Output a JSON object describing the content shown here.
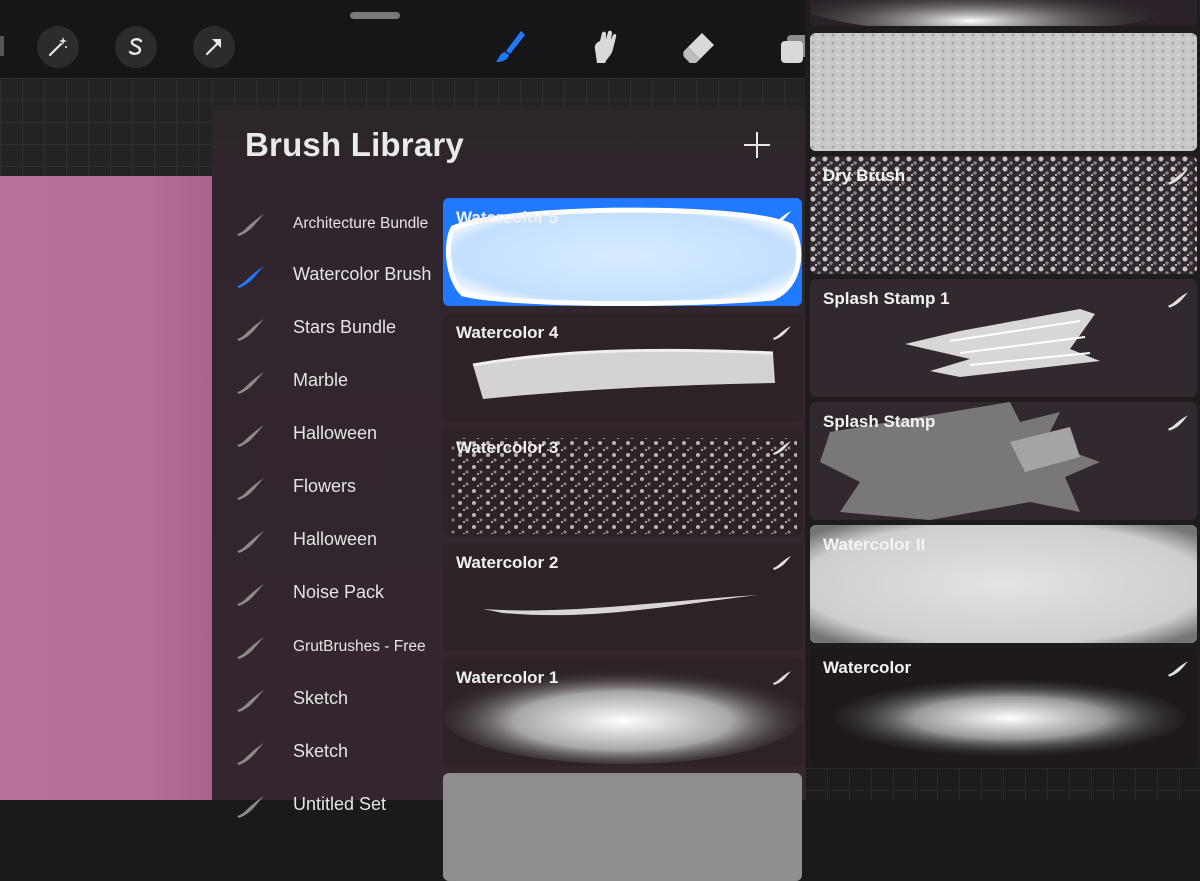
{
  "toolbar": {
    "left_tools": [
      "magic-wand-icon",
      "selection-s-icon",
      "transform-arrow-icon"
    ],
    "right_tools": [
      "brush-icon",
      "smudge-icon",
      "eraser-icon",
      "layers-icon"
    ],
    "accent": "#1f7aff"
  },
  "library": {
    "title": "Brush Library",
    "add_label": "+",
    "sets": [
      {
        "label": "Architecture Bundle",
        "selected": false
      },
      {
        "label": "Watercolor Brush",
        "selected": true
      },
      {
        "label": "Stars Bundle",
        "selected": false
      },
      {
        "label": "Marble",
        "selected": false
      },
      {
        "label": "Halloween",
        "selected": false
      },
      {
        "label": "Flowers",
        "selected": false
      },
      {
        "label": "Halloween",
        "selected": false
      },
      {
        "label": "Noise Pack",
        "selected": false
      },
      {
        "label": "GrutBrushes - Free",
        "selected": false
      },
      {
        "label": "Sketch",
        "selected": false
      },
      {
        "label": "Sketch",
        "selected": false
      },
      {
        "label": "Untitled Set",
        "selected": false
      }
    ],
    "brushes": [
      {
        "name": "Watercolor 5",
        "selected": true
      },
      {
        "name": "Watercolor 4",
        "selected": false
      },
      {
        "name": "Watercolor 3",
        "selected": false
      },
      {
        "name": "Watercolor 2",
        "selected": false
      },
      {
        "name": "Watercolor 1",
        "selected": false
      }
    ]
  },
  "right_panel": {
    "brushes": [
      {
        "name": ""
      },
      {
        "name": "Dry Brush"
      },
      {
        "name": "Splash Stamp  1"
      },
      {
        "name": "Splash Stamp"
      },
      {
        "name": "Watercolor II"
      },
      {
        "name": "Watercolor"
      }
    ]
  },
  "colors": {
    "canvas": "#b7709c",
    "library_bg": "#34262f",
    "selected_card": "#1f7aff"
  }
}
